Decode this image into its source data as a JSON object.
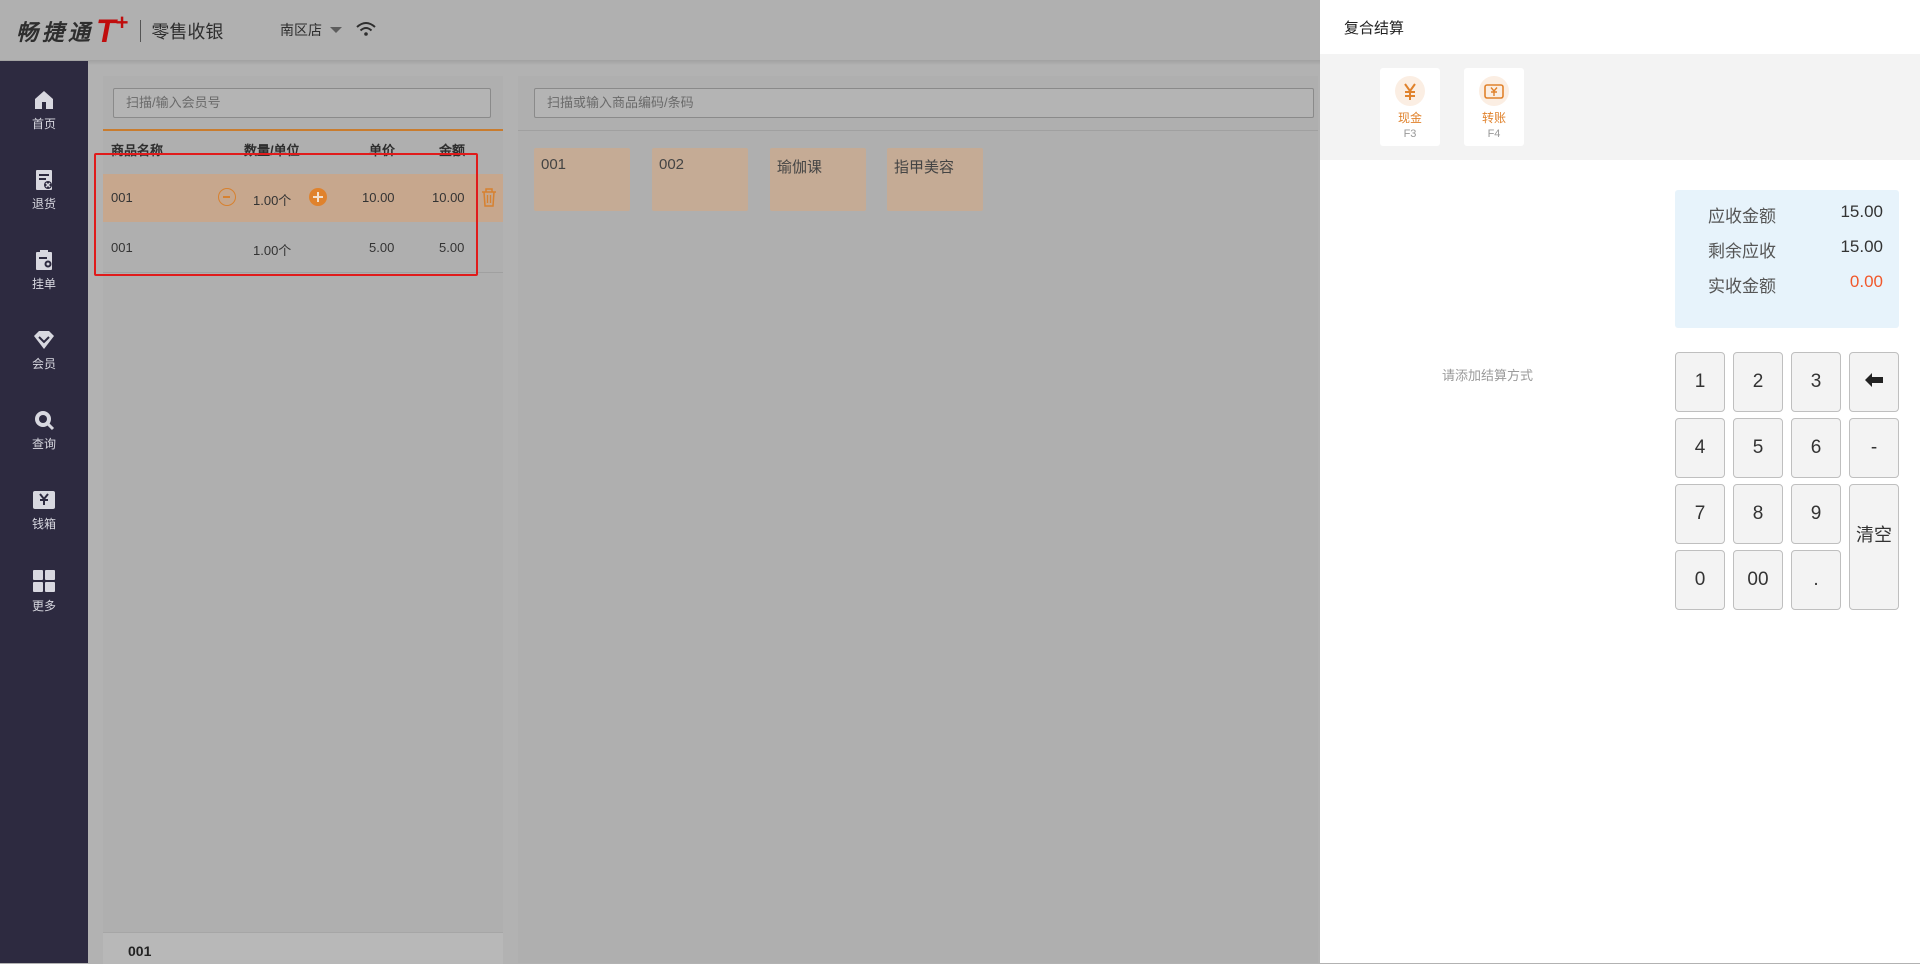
{
  "header": {
    "brand": "畅捷通",
    "brand_t": "T",
    "brand_plus": "+",
    "app_name": "零售收银",
    "store": "南区店"
  },
  "sidebar": {
    "items": [
      {
        "label": "首页",
        "icon": "home-icon"
      },
      {
        "label": "退货",
        "icon": "return-icon"
      },
      {
        "label": "挂单",
        "icon": "hold-order-icon"
      },
      {
        "label": "会员",
        "icon": "member-icon"
      },
      {
        "label": "查询",
        "icon": "search-icon"
      },
      {
        "label": "钱箱",
        "icon": "cash-box-icon"
      },
      {
        "label": "更多",
        "icon": "more-grid-icon"
      }
    ]
  },
  "cart": {
    "member_placeholder": "扫描/输入会员号",
    "columns": {
      "name": "商品名称",
      "qty": "数量/单位",
      "price": "单价",
      "amount": "金额"
    },
    "rows": [
      {
        "name": "001",
        "qty": "1.00个",
        "price": "10.00",
        "amount": "10.00",
        "selected": true
      },
      {
        "name": "001",
        "qty": "1.00个",
        "price": "5.00",
        "amount": "5.00",
        "selected": false
      }
    ],
    "footer_item": "001"
  },
  "products": {
    "search_placeholder": "扫描或输入商品编码/条码",
    "tiles": [
      "001",
      "002",
      "瑜伽课",
      "指甲美容"
    ]
  },
  "settle": {
    "title": "复合结算",
    "methods": [
      {
        "label": "现金",
        "key": "F3",
        "icon": "yuan-icon"
      },
      {
        "label": "转账",
        "key": "F4",
        "icon": "transfer-icon"
      }
    ],
    "hint": "请添加结算方式",
    "summary": {
      "due_label": "应收金额",
      "due": "15.00",
      "remaining_label": "剩余应收",
      "remaining": "15.00",
      "received_label": "实收金额",
      "received": "0.00"
    },
    "keypad": {
      "k1": "1",
      "k2": "2",
      "k3": "3",
      "k4": "4",
      "k5": "5",
      "k6": "6",
      "minus": "-",
      "k7": "7",
      "k8": "8",
      "k9": "9",
      "k0": "0",
      "k00": "00",
      "dot": ".",
      "clear": "清空"
    },
    "colors": {
      "accent": "#e0822c",
      "red": "#f1582b",
      "summary_bg": "#e7f3fb"
    }
  }
}
